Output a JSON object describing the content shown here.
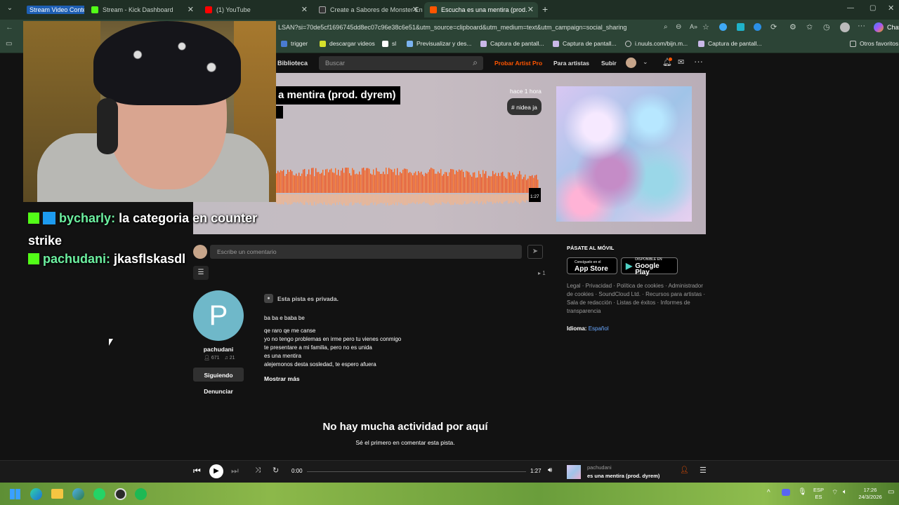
{
  "browser": {
    "tabs": [
      {
        "label": "Stream Video Content",
        "active": false
      },
      {
        "label": "Stream - Kick Dashboard",
        "active": false
      },
      {
        "label": "(1) YouTube",
        "active": false
      },
      {
        "label": "Create a Sabores de Monster Ener",
        "active": false
      },
      {
        "label": "Escucha es una mentira (prod. dyr",
        "active": true
      }
    ],
    "url": "LSAN?si=70de5cf1696745dd8ec07c96e38c6e51&utm_source=clipboard&utm_medium=text&utm_campaign=social_sharing",
    "copilot_label": "Chat",
    "bookmarks": [
      "trigger",
      "descargar videos",
      "sl",
      "Previsualizar y des...",
      "Captura de pantall...",
      "Captura de pantall...",
      "i.nuuls.com/bijn.m...",
      "Captura de pantall..."
    ],
    "other_bookmarks": "Otros favoritos"
  },
  "nav": {
    "library": "Biblioteca",
    "search_placeholder": "Buscar",
    "try_pro": "Probar Artist Pro",
    "for_artists": "Para artistas",
    "upload": "Subir"
  },
  "track": {
    "title": "a mentira (prod. dyrem)",
    "posted": "hace 1 hora",
    "tag": "# nidea ja",
    "duration_badge": "1:27"
  },
  "comments": {
    "placeholder": "Escribe un comentario",
    "reposts": "1"
  },
  "artist": {
    "avatar_letter": "P",
    "name": "pachudani",
    "followers": "671",
    "tracks": "21",
    "following_label": "Siguiendo",
    "report_label": "Denunciar"
  },
  "description": {
    "private_notice": "Esta pista es privada.",
    "lines": [
      "ba ba e baba be",
      "",
      "qe raro qe me canse",
      "yo no tengo problemas en irme pero tu vienes conmigo",
      "te presentare a mi familia, pero no es unida",
      "es una mentira",
      "alejemonos desta sosledad, te espero afuera"
    ],
    "show_more": "Mostrar más"
  },
  "empty_state": {
    "title": "No hay mucha actividad por aquí",
    "subtitle": "Sé el primero en comentar esta pista."
  },
  "sidebar": {
    "mobile_heading": "PÁSATE AL MÓVIL",
    "app_store_small": "Consíguelo en el",
    "app_store": "App Store",
    "google_play_small": "DISPONIBLE EN",
    "google_play": "Google Play",
    "footer_text": "Legal · Privacidad · Política de cookies · Administrador de cookies · SoundCloud Ltd. · Recursos para artistas · Sala de redacción · Listas de éxitos · Informes de transparencia",
    "language_label": "Idioma:",
    "language_value": "Español"
  },
  "player": {
    "current_time": "0:00",
    "total_time": "1:27",
    "progress": 0,
    "artist": "pachudani",
    "title": "es una mentira (prod. dyrem)"
  },
  "stream_chat": [
    {
      "user": "bycharly",
      "message": "la categoria en counter strike"
    },
    {
      "user": "pachudani",
      "message": "jkasflskasdl"
    }
  ],
  "taskbar": {
    "lang": "ESP",
    "lang_sub": "ES",
    "time": "17:26",
    "date": "24/3/2026"
  },
  "colors": {
    "accent": "#ff5500",
    "tab_bar": "#1f2f25",
    "toolbar": "#2c4436",
    "page_bg": "#121212",
    "kick_green": "#53fc18",
    "artist_avatar": "#6fb8c9"
  }
}
